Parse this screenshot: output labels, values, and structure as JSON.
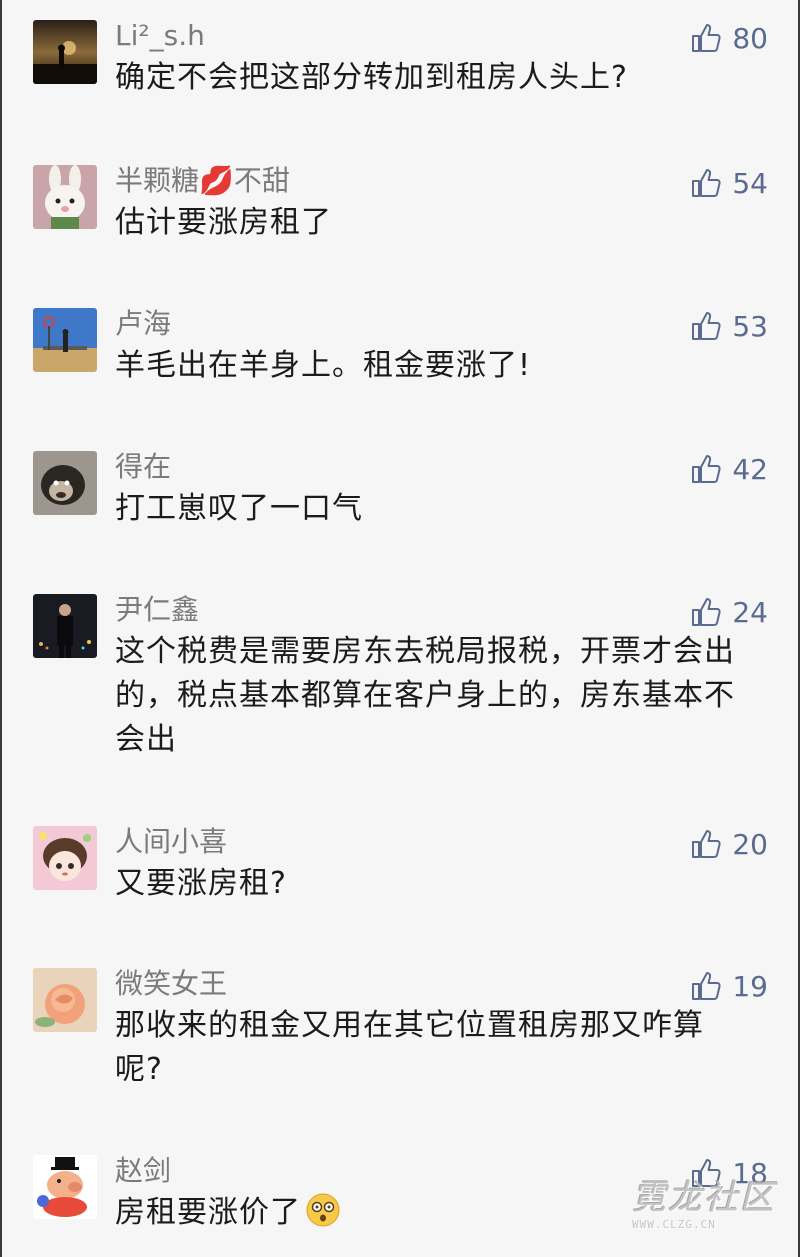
{
  "colors": {
    "background": "#f6f6f6",
    "username": "#7b7b7b",
    "text": "#1b1b1b",
    "like": "#5a6b8f"
  },
  "comments": [
    {
      "username": "Li²_s.h",
      "text": "确定不会把这部分转加到租房人头上?",
      "likes": "80",
      "avatar": "sunset-silhouette-avatar"
    },
    {
      "username": "半颗糖💋不甜",
      "text": "估计要涨房租了",
      "likes": "54",
      "avatar": "rabbit-avatar"
    },
    {
      "username": "卢海",
      "text": "羊毛出在羊身上。租金要涨了!",
      "likes": "53",
      "avatar": "beach-basket-avatar"
    },
    {
      "username": "得在",
      "text": "打工崽叹了一口气",
      "likes": "42",
      "avatar": "monkey-avatar"
    },
    {
      "username": "尹仁鑫",
      "text": "这个税费是需要房东去税局报税，开票才会出的，税点基本都算在客户身上的，房东基本不会出",
      "likes": "24",
      "avatar": "night-person-avatar"
    },
    {
      "username": "人间小喜",
      "text": "又要涨房租?",
      "likes": "20",
      "avatar": "anime-girl-avatar"
    },
    {
      "username": "微笑女王",
      "text": "那收来的租金又用在其它位置租房那又咋算呢?",
      "likes": "19",
      "avatar": "rose-avatar"
    },
    {
      "username": "赵剑",
      "text": "房租要涨价了",
      "likes": "18",
      "avatar": "cartoon-pig-avatar"
    }
  ],
  "watermark": {
    "title": "霓龙社区",
    "url": "WWW.CLZG.CN"
  }
}
